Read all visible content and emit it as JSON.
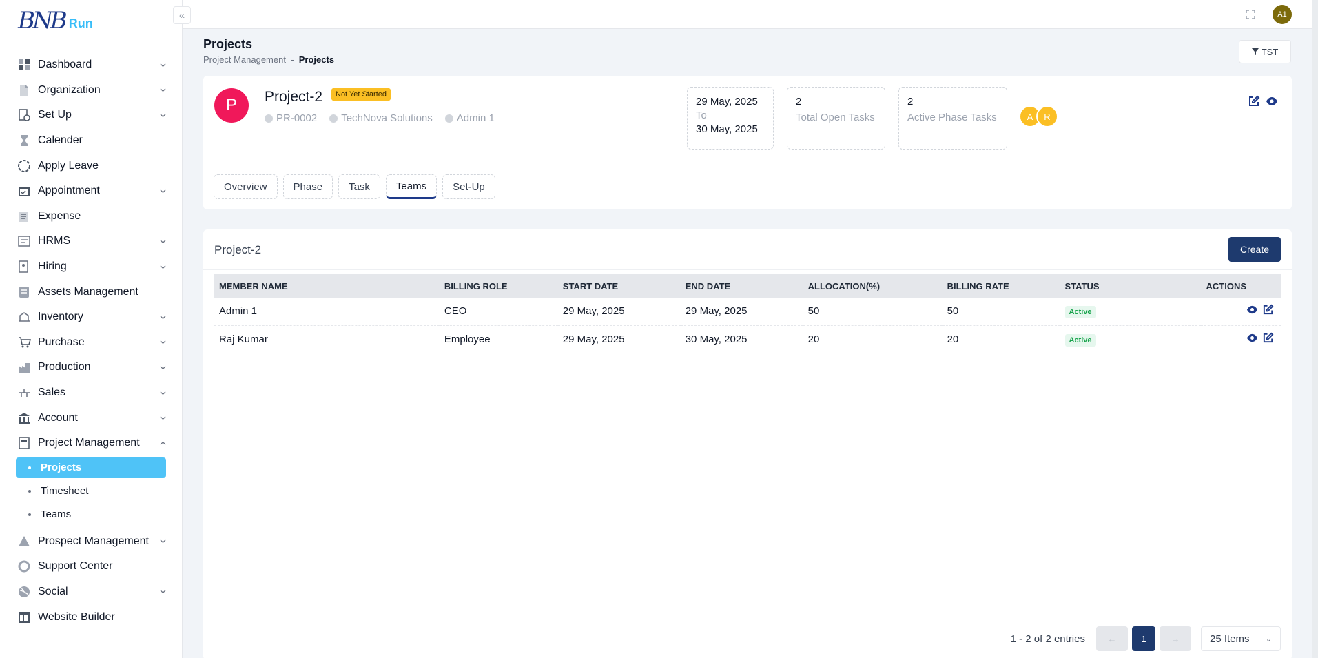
{
  "app": {
    "logo_text": "Run",
    "logo_mark": "BNB"
  },
  "sidebar": {
    "items": [
      {
        "label": "Dashboard",
        "icon": "dashboard-icon",
        "chevron": true
      },
      {
        "label": "Organization",
        "icon": "document-icon",
        "chevron": true
      },
      {
        "label": "Set Up",
        "icon": "setup-icon",
        "chevron": true
      },
      {
        "label": "Calender",
        "icon": "hourglass-icon",
        "chevron": false
      },
      {
        "label": "Apply Leave",
        "icon": "leave-icon",
        "chevron": false
      },
      {
        "label": "Appointment",
        "icon": "calendar-icon",
        "chevron": true
      },
      {
        "label": "Expense",
        "icon": "expense-icon",
        "chevron": false
      },
      {
        "label": "HRMS",
        "icon": "hrms-icon",
        "chevron": true
      },
      {
        "label": "Hiring",
        "icon": "hiring-icon",
        "chevron": true
      },
      {
        "label": "Assets Management",
        "icon": "assets-icon",
        "chevron": false
      },
      {
        "label": "Inventory",
        "icon": "inventory-icon",
        "chevron": true
      },
      {
        "label": "Purchase",
        "icon": "purchase-icon",
        "chevron": true
      },
      {
        "label": "Production",
        "icon": "production-icon",
        "chevron": true
      },
      {
        "label": "Sales",
        "icon": "sales-icon",
        "chevron": true
      },
      {
        "label": "Account",
        "icon": "bank-icon",
        "chevron": true
      },
      {
        "label": "Project Management",
        "icon": "project-icon",
        "chevron": true,
        "expanded": true
      }
    ],
    "sub_items": [
      {
        "label": "Projects",
        "active": true
      },
      {
        "label": "Timesheet",
        "active": false
      },
      {
        "label": "Teams",
        "active": false
      }
    ],
    "items_after": [
      {
        "label": "Prospect Management",
        "icon": "prospect-icon",
        "chevron": true
      },
      {
        "label": "Support Center",
        "icon": "support-icon",
        "chevron": false
      },
      {
        "label": "Social",
        "icon": "social-icon",
        "chevron": true
      },
      {
        "label": "Website Builder",
        "icon": "website-icon",
        "chevron": false
      }
    ]
  },
  "topbar": {
    "user_initials": "A1"
  },
  "header": {
    "title": "Projects",
    "breadcrumb_parent": "Project Management",
    "breadcrumb_sep": "-",
    "breadcrumb_current": "Projects",
    "filter_label": "TST"
  },
  "project": {
    "avatar_letter": "P",
    "name": "Project-2",
    "status": "Not Yet Started",
    "code": "PR-0002",
    "client": "TechNova Solutions",
    "owner": "Admin 1",
    "start_date": "29 May, 2025",
    "to_label": "To",
    "end_date": "30 May, 2025",
    "open_tasks_value": "2",
    "open_tasks_label": "Total Open Tasks",
    "phase_tasks_value": "2",
    "phase_tasks_label": "Active Phase Tasks",
    "members": [
      "A",
      "R"
    ],
    "tabs": [
      "Overview",
      "Phase",
      "Task",
      "Teams",
      "Set-Up"
    ],
    "active_tab": "Teams"
  },
  "teams": {
    "title": "Project-2",
    "create_label": "Create",
    "columns": [
      "MEMBER NAME",
      "BILLING ROLE",
      "START DATE",
      "END DATE",
      "ALLOCATION(%)",
      "BILLING RATE",
      "STATUS",
      "ACTIONS"
    ],
    "rows": [
      {
        "name": "Admin 1",
        "role": "CEO",
        "start": "29 May, 2025",
        "end": "29 May, 2025",
        "allocation": "50",
        "rate": "50",
        "status": "Active"
      },
      {
        "name": "Raj Kumar",
        "role": "Employee",
        "start": "29 May, 2025",
        "end": "30 May, 2025",
        "allocation": "20",
        "rate": "20",
        "status": "Active"
      }
    ],
    "entries_text": "1 - 2 of 2 entries",
    "prev_label": "←",
    "current_page": "1",
    "next_label": "→",
    "items_per_page": "25 Items"
  },
  "colors": {
    "accent": "#1e3a6e",
    "active_nav": "#4fc3f7",
    "badge": "#fbbf24",
    "avatar": "#f0185a"
  }
}
